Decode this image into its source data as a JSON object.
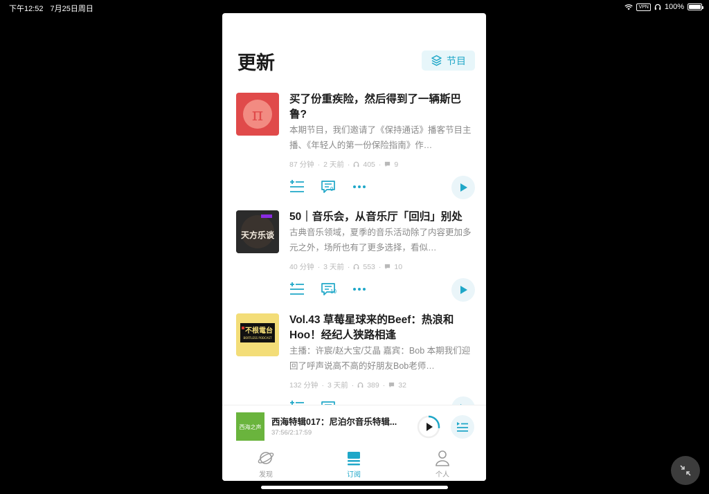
{
  "status_bar": {
    "time": "下午12:52",
    "date": "7月25日周日",
    "vpn": "VPN",
    "battery": "100%",
    "battery_level": 1.0
  },
  "header": {
    "title": "更新",
    "programs_button": "节目"
  },
  "episodes": [
    {
      "title": "买了份重疾险，然后得到了一辆斯巴鲁?",
      "description": "本期节目，我们邀请了《保持通话》播客节目主播、《年轻人的第一份保险指南》作…",
      "duration": "87 分钟",
      "age": "2 天前",
      "plays": "405",
      "comments": "9",
      "cover_text": "π",
      "cover_color": "#e04a4a"
    },
    {
      "title": "50｜音乐会，从音乐厅「回归」别处",
      "description": "古典音乐领域，夏季的音乐活动除了内容更加多元之外，场所也有了更多选择，看似…",
      "duration": "40 分钟",
      "age": "3 天前",
      "plays": "553",
      "comments": "10",
      "cover_text": "天方乐谈",
      "cover_color": "#2b2b2b"
    },
    {
      "title": "Vol.43 草莓星球来的Beef：热浪和Hoo！经纪人狭路相逢",
      "description": "主播：许宸/赵大宝/艾晶 嘉宾：Bob 本期我们迎回了呼声说高不高的好朋友Bob老师…",
      "duration": "132 分钟",
      "age": "3 天前",
      "plays": "389",
      "comments": "32",
      "cover_text": "不根電台",
      "cover_subtext": "BORTLESS PODCAST",
      "cover_color": "#f3dd78"
    }
  ],
  "mini_player": {
    "title": "西海特辑017：尼泊尔音乐特辑...",
    "time": "37:56/2:17:59",
    "cover_text": "西海之声",
    "progress": 0.27
  },
  "tabs": [
    {
      "label": "发现",
      "icon": "planet-icon",
      "active": false
    },
    {
      "label": "订阅",
      "icon": "stack-icon",
      "active": true
    },
    {
      "label": "个人",
      "icon": "person-icon",
      "active": false
    }
  ],
  "colors": {
    "accent": "#1fa7c8",
    "accent_light": "#eaf5f9"
  }
}
